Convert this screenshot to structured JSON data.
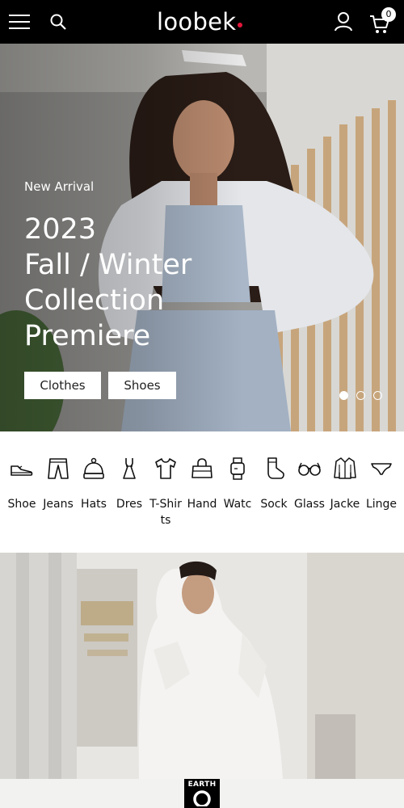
{
  "header": {
    "menu_icon": "hamburger-menu-icon",
    "search_icon": "search-icon",
    "logo_text": "loobek",
    "account_icon": "user-icon",
    "cart_icon": "cart-icon",
    "cart_count": "0",
    "background": "#000000",
    "accent": "#e4163a"
  },
  "hero": {
    "kicker": "New Arrival",
    "title_lines": [
      "2023",
      "Fall / Winter",
      "Collection",
      "Premiere"
    ],
    "buttons": [
      "Clothes",
      "Shoes"
    ],
    "slides": {
      "count": 3,
      "active": 1
    }
  },
  "categories": [
    {
      "label": "Shoe",
      "icon": "sneaker-icon"
    },
    {
      "label": "Jeans",
      "icon": "jeans-icon"
    },
    {
      "label": "Hats",
      "icon": "beanie-hat-icon"
    },
    {
      "label": "Dres",
      "icon": "dress-icon"
    },
    {
      "label": "T-Shirts",
      "icon": "tshirt-icon"
    },
    {
      "label": "Hand",
      "icon": "handbag-icon"
    },
    {
      "label": "Watc",
      "icon": "watch-icon"
    },
    {
      "label": "Sock",
      "icon": "sock-icon"
    },
    {
      "label": "Glass",
      "icon": "glasses-icon"
    },
    {
      "label": "Jacke",
      "icon": "jacket-icon"
    },
    {
      "label": "Linge",
      "icon": "lingerie-icon"
    }
  ],
  "footer_strip": {
    "brand_badge": "EARTH"
  }
}
